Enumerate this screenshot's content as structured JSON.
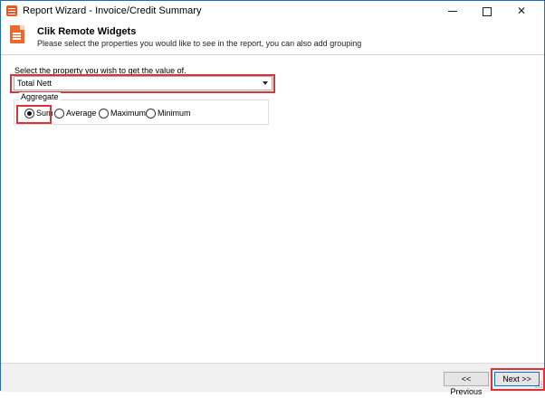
{
  "window": {
    "title": "Report Wizard - Invoice/Credit Summary",
    "controls": {
      "minimize": "minimize",
      "maximize": "maximize",
      "close": "✕"
    }
  },
  "header": {
    "title": "Clik Remote Widgets",
    "subtitle": "Please select the properties you would like to see in the report, you can also add grouping"
  },
  "form": {
    "property_label": "Select the property you wish to get the value of.",
    "property_value": "Total Nett",
    "aggregate_group_label": "Aggregate",
    "aggregate_options": [
      {
        "label": "Sum",
        "selected": true
      },
      {
        "label": "Average",
        "selected": false
      },
      {
        "label": "Maximum",
        "selected": false
      },
      {
        "label": "Minimum",
        "selected": false
      }
    ]
  },
  "footer": {
    "previous_label": "<< Previous",
    "next_label": "Next >>"
  },
  "colors": {
    "highlight": "#d9343a",
    "accent": "#0078d7",
    "icon": "#f0672a"
  }
}
